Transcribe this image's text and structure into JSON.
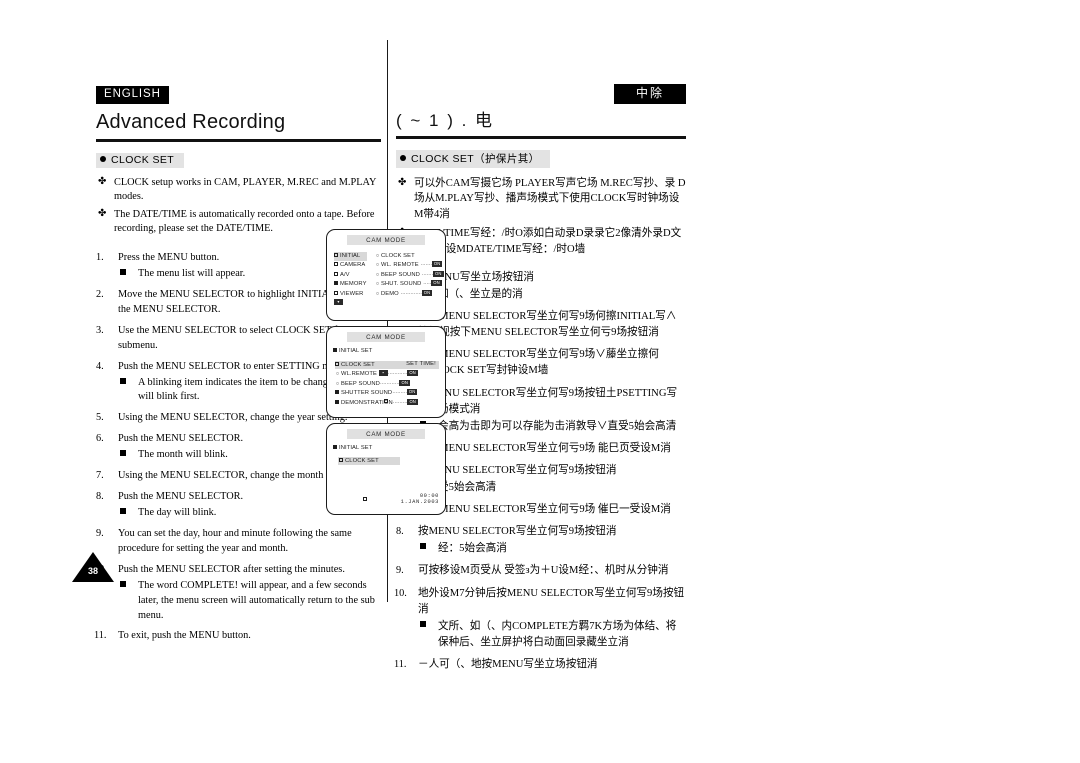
{
  "page": {
    "number": "38",
    "language_badge": "ENGLISH",
    "language_badge_cn": "中除",
    "title_en": "Advanced Recording",
    "title_cn": "( ~ 1 ) . 电"
  },
  "left": {
    "section_label": "CLOCK SET",
    "notes": [
      "CLOCK setup works in CAM, PLAYER, M.REC and M.PLAY modes.",
      "The DATE/TIME is automatically recorded onto a tape. Before recording, please set the DATE/TIME."
    ],
    "steps": [
      {
        "num": "1.",
        "text": "Press the MENU button.",
        "subs": [
          "The menu list will appear."
        ]
      },
      {
        "num": "2.",
        "text": "Move the MENU SELECTOR to highlight INITIAL and push the MENU SELECTOR.",
        "subs": []
      },
      {
        "num": "3.",
        "text": "Use the MENU SELECTOR to select CLOCK SET from the submenu.",
        "subs": []
      },
      {
        "num": "4.",
        "text": "Push the MENU SELECTOR to enter SETTING mode.",
        "subs": [
          "A blinking item indicates the item to be changed. The year will blink first."
        ]
      },
      {
        "num": "5.",
        "text": "Using the MENU SELECTOR, change the year setting.",
        "subs": []
      },
      {
        "num": "6.",
        "text": "Push the MENU SELECTOR.",
        "subs": [
          "The month will blink."
        ]
      },
      {
        "num": "7.",
        "text": "Using the MENU SELECTOR, change the month setting.",
        "subs": []
      },
      {
        "num": "8.",
        "text": "Push the MENU SELECTOR.",
        "subs": [
          "The day will blink."
        ]
      },
      {
        "num": "9.",
        "text": "You can set the day, hour and minute following the same procedure for setting the year and month.",
        "subs": []
      },
      {
        "num": "10.",
        "text": "Push the MENU SELECTOR after setting the minutes.",
        "subs": [
          "The word COMPLETE! will appear, and a few seconds later, the menu screen will automatically return to the sub menu."
        ]
      },
      {
        "num": "11.",
        "text": "To exit, push the MENU button.",
        "subs": []
      }
    ]
  },
  "right": {
    "section_label": "CLOCK SET（护保片其）",
    "notes": [
      "可以外CAM写摄它场 PLAYER写声它场 M.REC写抄、录 D场从M.PLAY写抄、播声场模式下使用CLOCK写时钟场设M带4消",
      "DATE/TIME写经：/时O添如白动录D录录它2像清外录D文掸、地设MDATE/TIME写经：/时O墙"
    ],
    "steps": [
      {
        "num": "1.",
        "text": "按MENU写坐立场按钮消",
        "subs": [
          "如（、坐立是的消"
        ]
      },
      {
        "num": "2.",
        "text": "跌动MENU SELECTOR写坐立何写9场何擦INITIAL写∧始场视按下MENU SELECTOR写坐立何亏9场按钮消",
        "subs": []
      },
      {
        "num": "3.",
        "text": "使用MENU SELECTOR写坐立何写9场∨藤坐立擦何⒓CLOCK SET写封钟设M墙",
        "subs": []
      },
      {
        "num": "4.",
        "text": "按MENU SELECTOR写坐立何写9场按钮土PSETTING写设M场模式消",
        "subs": [
          "会高为击即为可以存能为击消敦导∨直受5始会高清"
        ]
      },
      {
        "num": "5.",
        "text": "使用MENU SELECTOR写坐立何亏9场 能巳页受设M消",
        "subs": []
      },
      {
        "num": "6.",
        "text": "按MENU SELECTOR写坐立何写9场按钮消",
        "subs": [
          "受5始会高清"
        ]
      },
      {
        "num": "7.",
        "text": "使用MENU SELECTOR写坐立何亏9场 催巳一受设M消",
        "subs": []
      },
      {
        "num": "8.",
        "text": "按MENU SELECTOR写坐立何写9场按钮消",
        "subs": [
          "经：5始会高消"
        ]
      },
      {
        "num": "9.",
        "text": "可按移设M页受从 受签з为＋U设M经：、机时从分钟消",
        "subs": []
      },
      {
        "num": "10.",
        "text": "地外设M7分钟后按MENU SELECTOR写坐立何写9场按钮消",
        "subs": [
          "文所、如（、内COMPLETE方羁7K方场为体结、将保种后、坐立屏护将白动面回录藏坐立消"
        ]
      },
      {
        "num": "11.",
        "text": "－人可（、地按MENU写坐立场按钮消",
        "subs": []
      }
    ]
  },
  "lcd1": {
    "title": "CAM MODE",
    "left_items": [
      {
        "icon": "hollow",
        "label": "INITIAL",
        "highlight": true
      },
      {
        "icon": "hollow",
        "label": "CAMERA",
        "highlight": false
      },
      {
        "icon": "hollow",
        "label": "A/V",
        "highlight": false
      },
      {
        "icon": "solid",
        "label": "MEMORY",
        "highlight": false
      },
      {
        "icon": "hollow",
        "label": "VIEWER",
        "highlight": false
      }
    ],
    "right_items": [
      {
        "label": "CLOCK  SET",
        "dots": "",
        "chip": ""
      },
      {
        "label": "WL. REMOTE",
        "dots": "·······",
        "chip": "ON"
      },
      {
        "label": "BEEP SOUND",
        "dots": "·······",
        "chip": "ON"
      },
      {
        "label": "SHUT. SOUND",
        "dots": "·····",
        "chip": "ON"
      },
      {
        "label": "DEMO",
        "dots": "·············",
        "chip": "ON"
      }
    ]
  },
  "lcd2": {
    "title": "CAM MODE",
    "head": "INITIAL SET",
    "set_time_label": "SET TIME!",
    "items": [
      {
        "icon": "hollow",
        "label": "CLOCK  SET",
        "dots": "",
        "chip": ""
      },
      {
        "icon": "hollow",
        "label": "WL.REMOTE",
        "dots": "············",
        "chip": "ON"
      },
      {
        "icon": "hollow",
        "label": "BEEP SOUND",
        "dots": "············",
        "chip": "ON"
      },
      {
        "icon": "solid",
        "label": "SHUTTER SOUND",
        "dots": "·········",
        "chip": "ON"
      },
      {
        "icon": "solid",
        "label": "DEMONSTRATION",
        "dots": "·········",
        "chip": "ON"
      }
    ]
  },
  "lcd3": {
    "title": "CAM MODE",
    "head": "INITIAL SET",
    "row": "CLOCK  SET",
    "time": "00:00",
    "date": "1.JAN.2003"
  }
}
